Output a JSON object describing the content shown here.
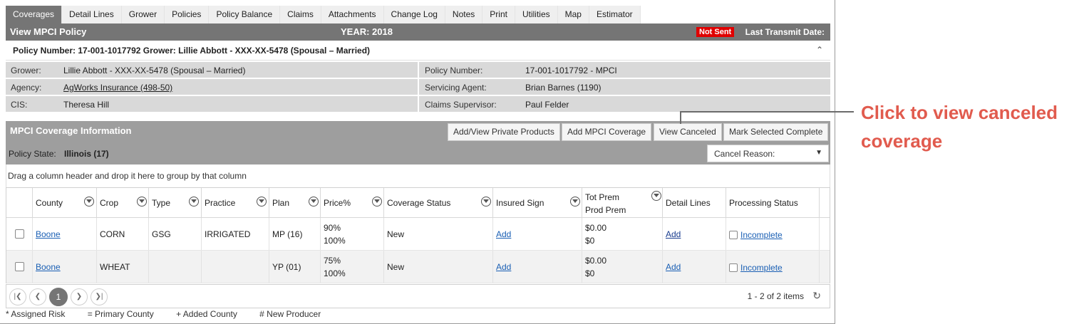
{
  "tabs": [
    {
      "label": "Coverages",
      "active": true
    },
    {
      "label": "Detail Lines"
    },
    {
      "label": "Grower"
    },
    {
      "label": "Policies"
    },
    {
      "label": "Policy Balance"
    },
    {
      "label": "Claims"
    },
    {
      "label": "Attachments"
    },
    {
      "label": "Change Log"
    },
    {
      "label": "Notes"
    },
    {
      "label": "Print"
    },
    {
      "label": "Utilities"
    },
    {
      "label": "Map"
    },
    {
      "label": "Estimator"
    }
  ],
  "titlebar": {
    "title": "View MPCI Policy",
    "year": "YEAR: 2018",
    "status_badge": "Not Sent",
    "last_transmit": "Last Transmit Date:"
  },
  "policy_header": {
    "text": "Policy Number: 17-001-1017792 Grower: Lillie Abbott - XXX-XX-5478 (Spousal – Married)",
    "collapse_icon": "chevron-up-icon"
  },
  "info": {
    "grower_label": "Grower:",
    "grower_value": "Lillie Abbott - XXX-XX-5478 (Spousal – Married)",
    "agency_label": "Agency:",
    "agency_value": "AgWorks Insurance (498-50)",
    "cis_label": "CIS:",
    "cis_value": "Theresa Hill",
    "policy_number_label": "Policy Number:",
    "policy_number_value": "17-001-1017792 - MPCI",
    "servicing_agent_label": "Servicing Agent:",
    "servicing_agent_value": "Brian Barnes (1190)",
    "claims_supervisor_label": "Claims Supervisor:",
    "claims_supervisor_value": "Paul Felder"
  },
  "coverage": {
    "title": "MPCI Coverage Information",
    "btn_private": "Add/View Private Products",
    "btn_add": "Add MPCI Coverage",
    "btn_canceled": "View Canceled",
    "btn_complete": "Mark Selected Complete",
    "policy_state_label": "Policy State:",
    "policy_state_value": "Illinois (17)",
    "cancel_reason": "Cancel Reason:",
    "drag_hint": "Drag a column header and drop it here to group by that column"
  },
  "grid": {
    "headers": {
      "county": "County",
      "crop": "Crop",
      "type": "Type",
      "practice": "Practice",
      "plan": "Plan",
      "price": "Price%",
      "coverage_status": "Coverage Status",
      "insured_sign": "Insured Sign",
      "tot_prem": "Tot Prem",
      "prod_prem": "Prod Prem",
      "detail_lines": "Detail Lines",
      "processing_status": "Processing Status"
    },
    "rows": [
      {
        "county": "Boone",
        "crop": "CORN",
        "type": "GSG",
        "practice": "IRRIGATED",
        "plan": "MP (16)",
        "price_1": "90%",
        "price_2": "100%",
        "coverage_status": "New",
        "insured_sign": "Add",
        "tot_prem": "$0.00",
        "prod_prem": "$0",
        "detail_lines": "Add",
        "processing_status": "Incomplete"
      },
      {
        "county": "Boone",
        "crop": "WHEAT",
        "type": "",
        "practice": "",
        "plan": "YP (01)",
        "price_1": "75%",
        "price_2": "100%",
        "coverage_status": "New",
        "insured_sign": "Add",
        "tot_prem": "$0.00",
        "prod_prem": "$0",
        "detail_lines": "Add",
        "processing_status": "Incomplete"
      }
    ]
  },
  "pager": {
    "current_page": "1",
    "info": "1 - 2 of 2 items"
  },
  "legend": {
    "assigned": "* Assigned Risk",
    "primary": "= Primary County",
    "added": "+ Added County",
    "new_producer": "# New Producer"
  },
  "annotation": {
    "text": "Click to view canceled coverage",
    "color": "#e15b4e"
  }
}
